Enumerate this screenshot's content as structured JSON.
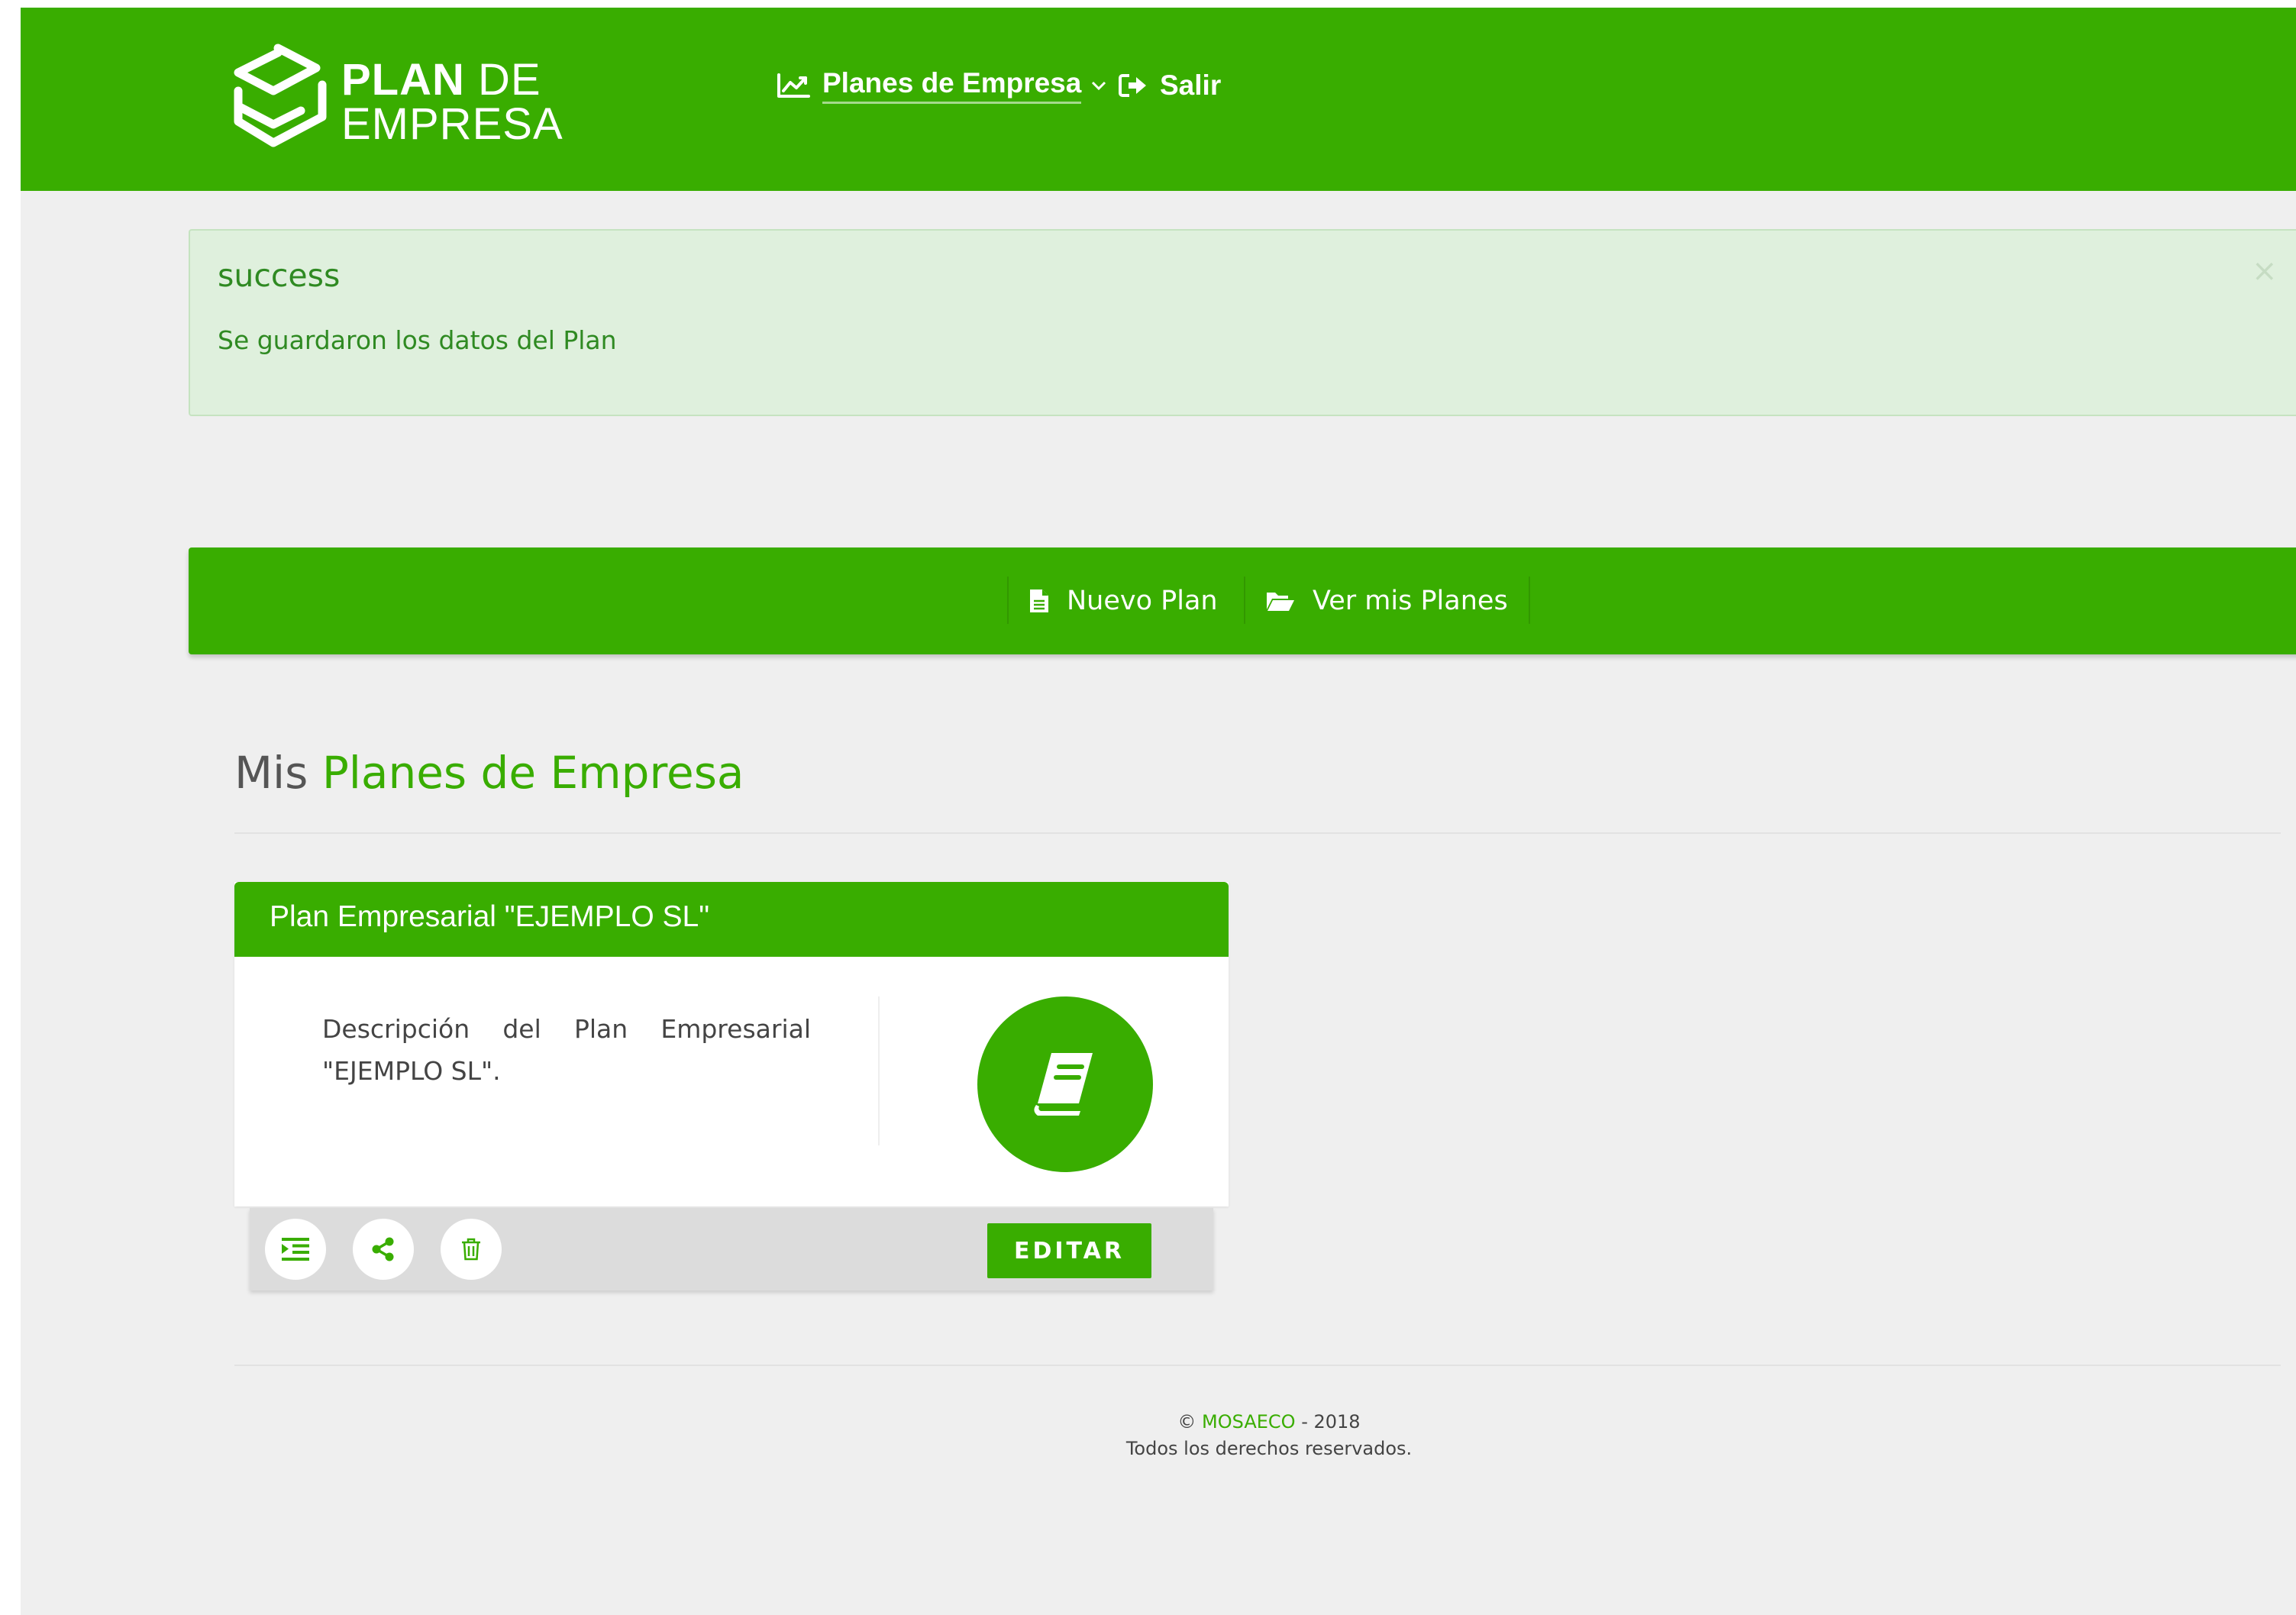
{
  "header": {
    "logo_line1_bold": "PLAN",
    "logo_line1_light": "DE",
    "logo_line2": "EMPRESA",
    "nav": {
      "plans_label": "Planes de Empresa",
      "exit_label": "Salir"
    }
  },
  "alert": {
    "title": "success",
    "message": "Se guardaron los datos del Plan",
    "close_glyph": "×"
  },
  "actions": {
    "new_plan_label": "Nuevo Plan",
    "view_plans_label": "Ver mis Planes"
  },
  "section": {
    "title_prefix": "Mis",
    "title_highlight": "Planes de Empresa"
  },
  "card": {
    "title": "Plan Empresarial \"EJEMPLO SL\"",
    "description": "Descripción del Plan Empresarial \"EJEMPLO SL\".",
    "edit_label": "EDITAR"
  },
  "footer": {
    "copyright_symbol": "©",
    "brand": "MOSAECO",
    "year_text": "- 2018",
    "rights": "Todos los derechos reservados."
  },
  "colors": {
    "brand_green": "#39ad00",
    "alert_bg": "#dff0dd",
    "alert_text": "#2f8a22",
    "page_bg": "#efefef"
  },
  "icons": {
    "logo": "cube-logo-icon",
    "plans": "line-chart-icon",
    "exit": "sign-out-icon",
    "new_plan": "file-icon",
    "view_plans": "folder-open-icon",
    "card_center": "book-icon",
    "outline": "indent-list-icon",
    "share": "share-icon",
    "delete": "trash-icon"
  }
}
